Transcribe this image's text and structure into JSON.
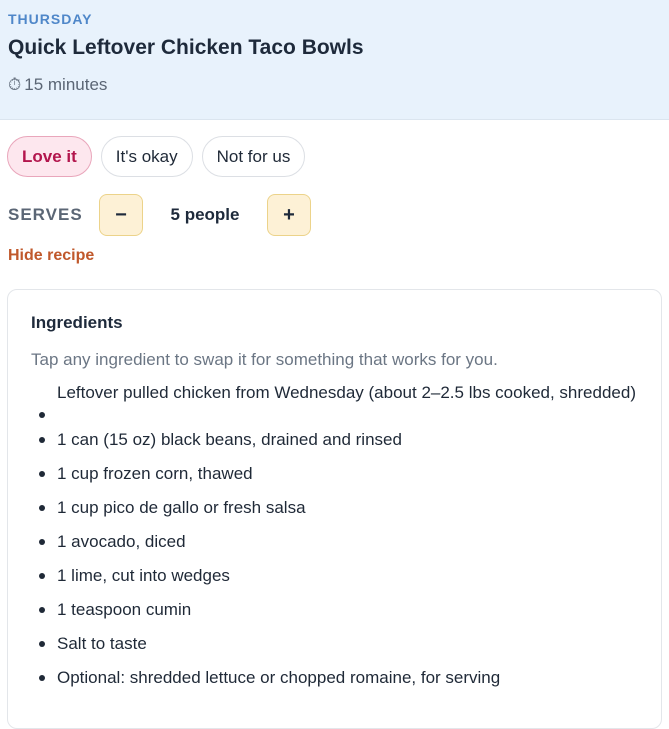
{
  "header": {
    "day": "THURSDAY",
    "title": "Quick Leftover Chicken Taco Bowls",
    "time_icon": "stopwatch-icon",
    "time": "15 minutes"
  },
  "ratings": {
    "options": [
      "Love it",
      "It's okay",
      "Not for us"
    ],
    "selected": "Love it"
  },
  "serves": {
    "label": "SERVES",
    "value": "5 people",
    "decrement_label": "−",
    "increment_label": "+"
  },
  "toggle": {
    "label": "Hide recipe"
  },
  "ingredients": {
    "title": "Ingredients",
    "hint": "Tap any ingredient to swap it for something that works for you.",
    "items": [
      "Leftover pulled chicken from Wednesday (about 2–2.5 lbs cooked, shredded)",
      "1 can (15 oz) black beans, drained and rinsed",
      "1 cup frozen corn, thawed",
      "1 cup pico de gallo or fresh salsa",
      "1 avocado, diced",
      "1 lime, cut into wedges",
      "1 teaspoon cumin",
      "Salt to taste",
      "Optional: shredded lettuce or chopped romaine, for serving"
    ]
  },
  "colors": {
    "header_bg": "#e8f2fc",
    "accent_blue": "#4f87c9",
    "love_bg": "#fde7ee",
    "love_text": "#b3164d",
    "stepper_bg": "#fdf1d6",
    "link_orange": "#c0582b"
  }
}
